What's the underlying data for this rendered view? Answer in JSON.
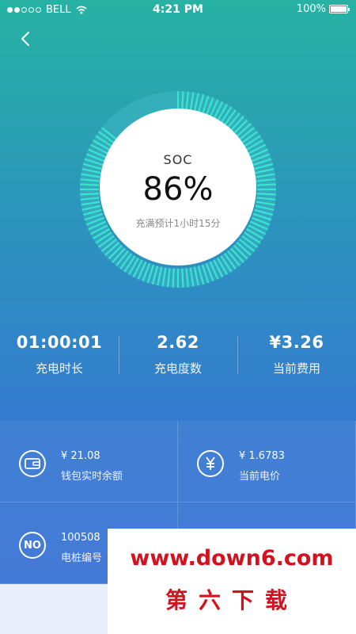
{
  "status_bar": {
    "carrier": "BELL",
    "time": "4:21 PM",
    "battery": "100%"
  },
  "charging": {
    "soc_label": "SOC",
    "soc_value": "86%",
    "soc_fraction": 0.86,
    "eta": "充满预计1小时15分"
  },
  "stats": [
    {
      "value": "01:00:01",
      "label": "充电时长"
    },
    {
      "value": "2.62",
      "label": "充电度数"
    },
    {
      "value": "¥3.26",
      "label": "当前费用"
    }
  ],
  "info": {
    "wallet": {
      "value": "¥ 21.08",
      "label": "钱包实时余额",
      "icon": "wallet-icon"
    },
    "price": {
      "value": "¥ 1.6783",
      "label": "当前电价",
      "icon": "yen-icon"
    },
    "pile": {
      "value": "100508",
      "label": "电桩编号",
      "icon_text": "NO"
    }
  },
  "watermark": {
    "url": "www.down6.com",
    "name": "第六下载"
  },
  "colors": {
    "gauge_fill": "#37e6cf",
    "gauge_track": "#3fb8c4",
    "watermark": "#d4111e"
  }
}
